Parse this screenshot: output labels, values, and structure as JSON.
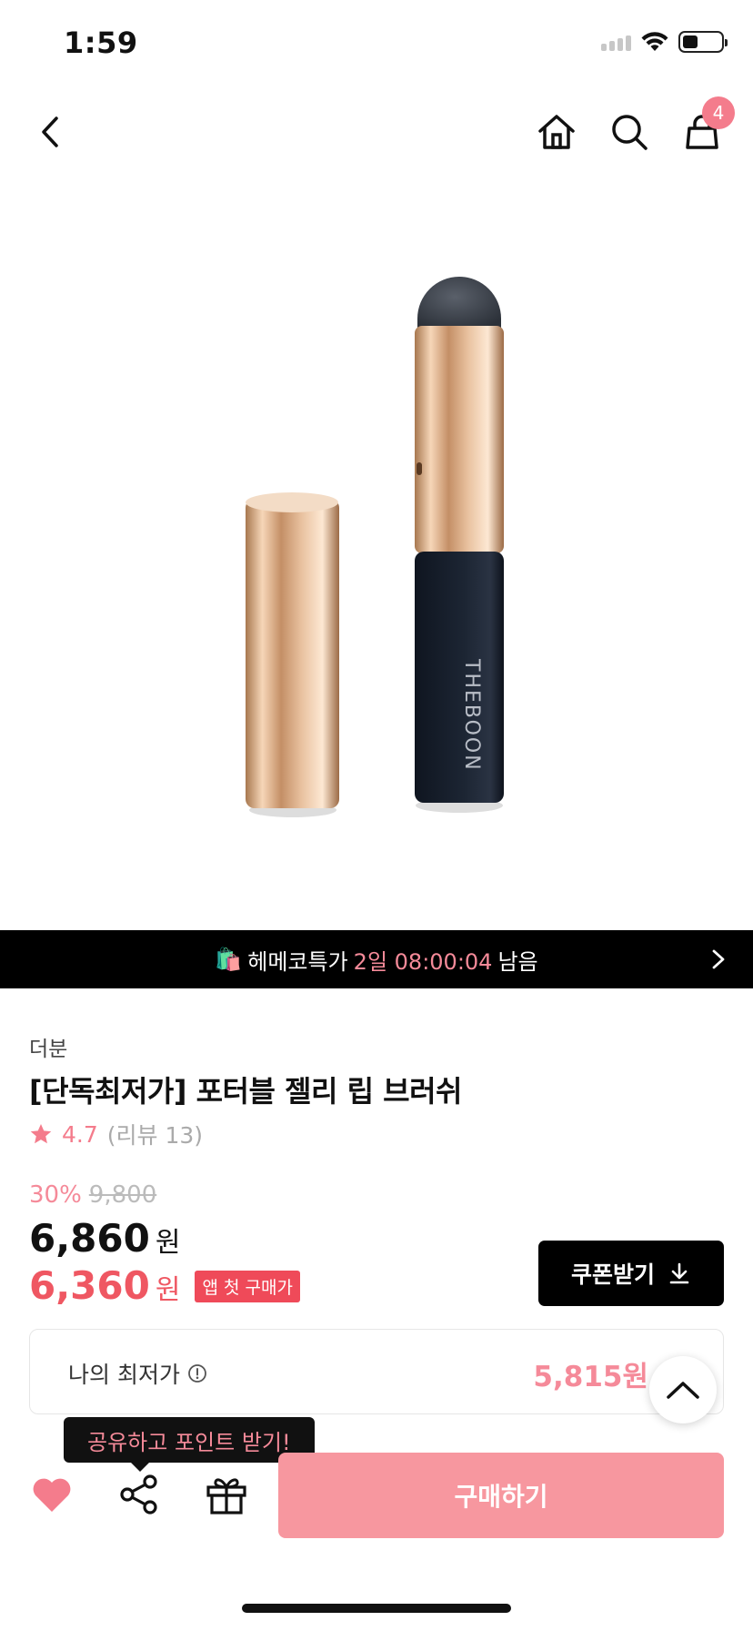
{
  "status_bar": {
    "time": "1:59"
  },
  "nav": {
    "cart_count": "4"
  },
  "product_image": {
    "label": "THEBOON"
  },
  "timer_banner": {
    "emoji": "🛍️",
    "label": "헤메코특가",
    "countdown": "2일 08:00:04",
    "suffix": "남음"
  },
  "product": {
    "brand": "더분",
    "title": "[단독최저가] 포터블 젤리 립 브러쉬",
    "rating": "4.7",
    "reviews": "(리뷰 13)",
    "discount": "30%",
    "original_price": "9,800",
    "price": "6,860",
    "price_unit": "원",
    "app_price": "6,360",
    "app_price_unit": "원",
    "app_badge": "앱 첫 구매가"
  },
  "coupon": {
    "label": "쿠폰받기"
  },
  "lowest": {
    "label": "나의 최저가",
    "value": "5,815원"
  },
  "tooltip": {
    "text": "공유하고 포인트 받기!"
  },
  "buy": {
    "label": "구매하기"
  },
  "colors": {
    "accent": "#f47c8c",
    "buy_button": "#f7979f",
    "app_price": "#ef5762"
  }
}
